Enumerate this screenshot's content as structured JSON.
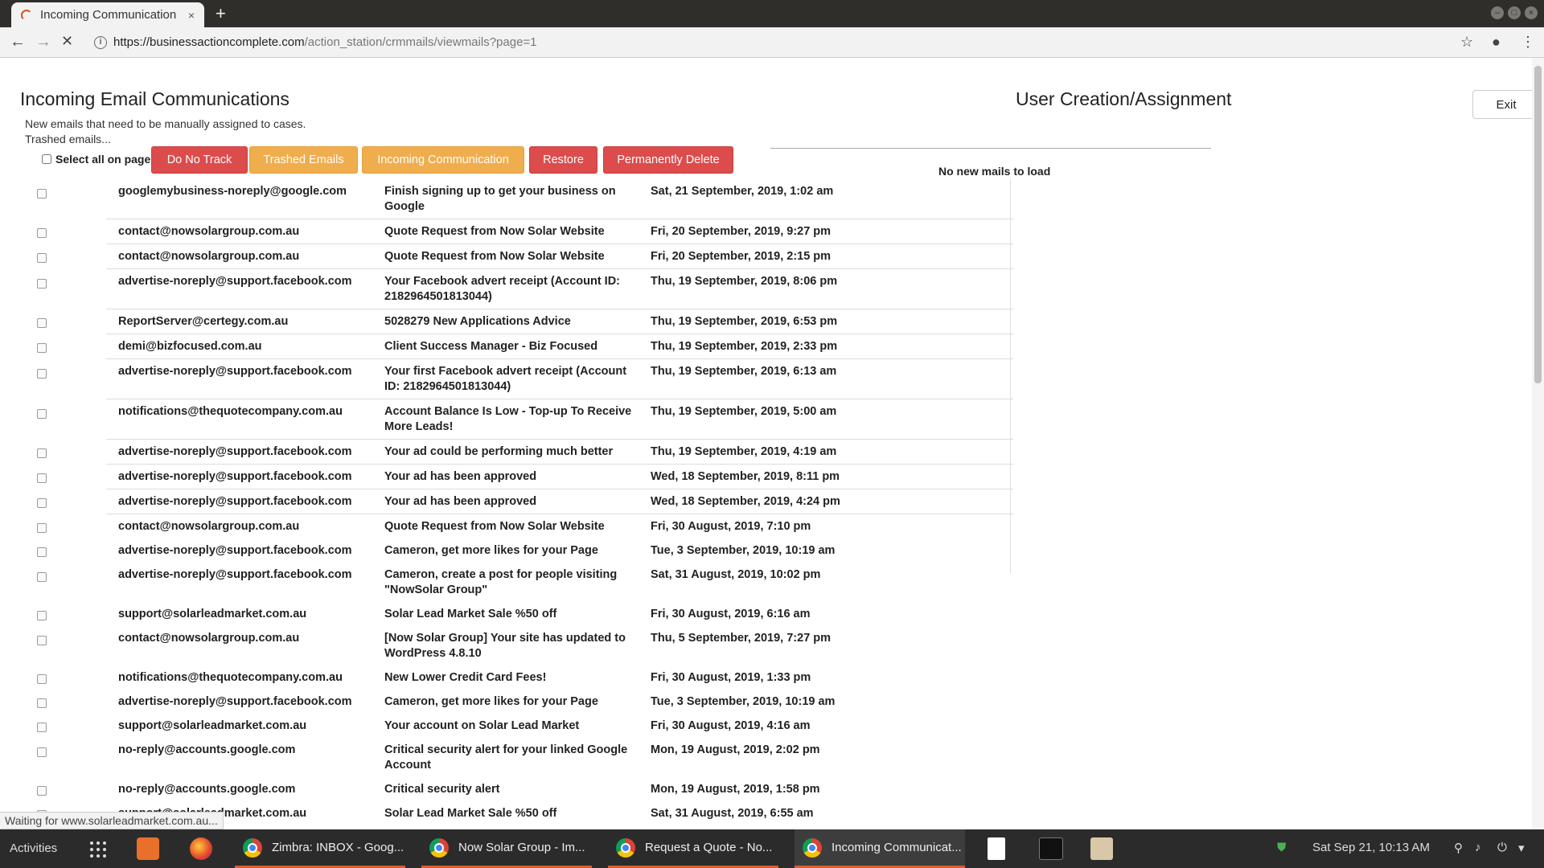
{
  "browser": {
    "tab_title": "Incoming Communication",
    "tab_close": "×",
    "new_tab": "+",
    "url_host": "https://businessactioncomplete.com",
    "url_path": "/action_station/crmmails/viewmails?page=1"
  },
  "left": {
    "title": "Incoming Email Communications",
    "desc1": "New emails that need to be manually assigned to cases.",
    "desc2": "Trashed emails...",
    "select_all": "Select all on page",
    "buttons": {
      "do_not_track": "Do No Track",
      "trashed": "Trashed Emails",
      "incoming": "Incoming Communication",
      "restore": "Restore",
      "delete": "Permanently Delete"
    }
  },
  "right": {
    "title": "User Creation/Assignment",
    "exit": "Exit",
    "no_mails": "No new mails to load"
  },
  "colors": {
    "red": "#dc4c4c",
    "orange": "#f0ad4e"
  },
  "emails": [
    {
      "from": "googlemybusiness-noreply@google.com",
      "subject": "Finish signing up to get your business on Google",
      "date": "Sat, 21 September, 2019, 1:02 am"
    },
    {
      "from": "contact@nowsolargroup.com.au",
      "subject": "Quote Request from Now Solar Website",
      "date": "Fri, 20 September, 2019, 9:27 pm"
    },
    {
      "from": "contact@nowsolargroup.com.au",
      "subject": "Quote Request from Now Solar Website",
      "date": "Fri, 20 September, 2019, 2:15 pm"
    },
    {
      "from": "advertise-noreply@support.facebook.com",
      "subject": "Your Facebook advert receipt (Account ID: 2182964501813044)",
      "date": "Thu, 19 September, 2019, 8:06 pm"
    },
    {
      "from": "ReportServer@certegy.com.au",
      "subject": "5028279 New Applications Advice",
      "date": "Thu, 19 September, 2019, 6:53 pm"
    },
    {
      "from": "demi@bizfocused.com.au",
      "subject": "Client Success Manager - Biz Focused",
      "date": "Thu, 19 September, 2019, 2:33 pm"
    },
    {
      "from": "advertise-noreply@support.facebook.com",
      "subject": "Your first Facebook advert receipt (Account ID: 2182964501813044)",
      "date": "Thu, 19 September, 2019, 6:13 am"
    },
    {
      "from": "notifications@thequotecompany.com.au",
      "subject": "Account Balance Is Low - Top-up To Receive More Leads!",
      "date": "Thu, 19 September, 2019, 5:00 am"
    },
    {
      "from": "advertise-noreply@support.facebook.com",
      "subject": "Your ad could be performing much better",
      "date": "Thu, 19 September, 2019, 4:19 am"
    },
    {
      "from": "advertise-noreply@support.facebook.com",
      "subject": "Your ad has been approved",
      "date": "Wed, 18 September, 2019, 8:11 pm"
    },
    {
      "from": "advertise-noreply@support.facebook.com",
      "subject": "Your ad has been approved",
      "date": "Wed, 18 September, 2019, 4:24 pm"
    },
    {
      "from": "contact@nowsolargroup.com.au",
      "subject": "Quote Request from Now Solar Website",
      "date": "Fri, 30 August, 2019, 7:10 pm"
    },
    {
      "from": "advertise-noreply@support.facebook.com",
      "subject": "Cameron, get more likes for your Page",
      "date": "Tue, 3 September, 2019, 10:19 am"
    },
    {
      "from": "advertise-noreply@support.facebook.com",
      "subject": "Cameron, create a post for people visiting \"NowSolar Group\"",
      "date": "Sat, 31 August, 2019, 10:02 pm"
    },
    {
      "from": "support@solarleadmarket.com.au",
      "subject": "Solar Lead Market Sale %50 off",
      "date": "Fri, 30 August, 2019, 6:16 am"
    },
    {
      "from": "contact@nowsolargroup.com.au",
      "subject": "[Now Solar Group] Your site has updated to WordPress 4.8.10",
      "date": "Thu, 5 September, 2019, 7:27 pm"
    },
    {
      "from": "notifications@thequotecompany.com.au",
      "subject": "New Lower Credit Card Fees!",
      "date": "Fri, 30 August, 2019, 1:33 pm"
    },
    {
      "from": "advertise-noreply@support.facebook.com",
      "subject": "Cameron, get more likes for your Page",
      "date": "Tue, 3 September, 2019, 10:19 am"
    },
    {
      "from": "support@solarleadmarket.com.au",
      "subject": "Your account on Solar Lead Market",
      "date": "Fri, 30 August, 2019, 4:16 am"
    },
    {
      "from": "no-reply@accounts.google.com",
      "subject": "Critical security alert for your linked Google Account",
      "date": "Mon, 19 August, 2019, 2:02 pm"
    },
    {
      "from": "no-reply@accounts.google.com",
      "subject": "Critical security alert",
      "date": "Mon, 19 August, 2019, 1:58 pm"
    },
    {
      "from": "support@solarleadmarket.com.au",
      "subject": "Solar Lead Market Sale %50 off",
      "date": "Sat, 31 August, 2019, 6:55 am"
    }
  ],
  "status": "Waiting for www.solarleadmarket.com.au...",
  "taskbar": {
    "activities": "Activities",
    "tasks": [
      "Zimbra: INBOX - Goog...",
      "Now Solar Group - Im...",
      "Request a Quote - No...",
      "Incoming Communicat..."
    ],
    "clock": "Sat Sep 21, 10:13 AM"
  }
}
